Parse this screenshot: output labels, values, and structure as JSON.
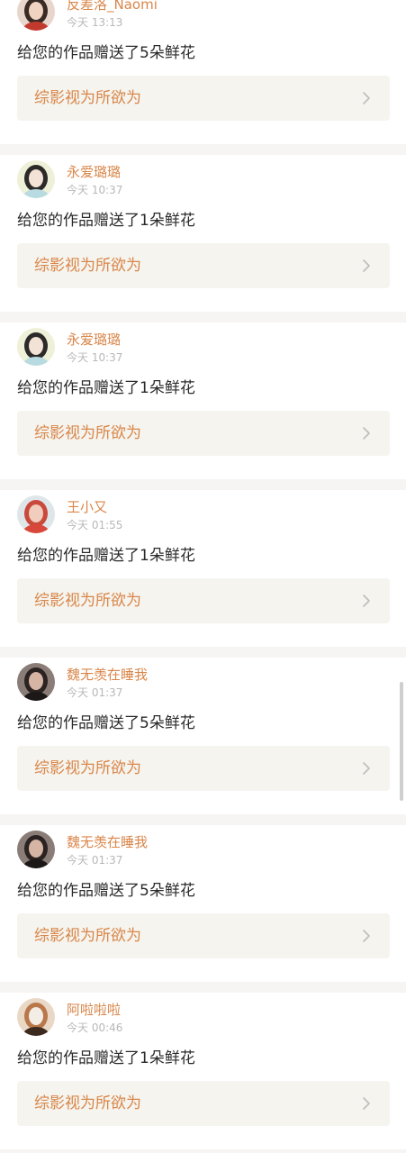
{
  "notifications": [
    {
      "user": "反差洛_Naomi",
      "time": "今天 13:13",
      "message": "给您的作品赠送了5朵鲜花",
      "work_title": "综影视为所欲为",
      "avatar": {
        "bg": "#e8d6cc",
        "hair": "#3a2a24",
        "skin": "#f1d3c2",
        "accent": "#c23a2e"
      }
    },
    {
      "user": "永爱璐璐",
      "time": "今天 10:37",
      "message": "给您的作品赠送了1朵鲜花",
      "work_title": "综影视为所欲为",
      "avatar": {
        "bg": "#eef0d8",
        "hair": "#2c2a28",
        "skin": "#f3e2d6",
        "accent": "#b7dbe0"
      }
    },
    {
      "user": "永爱璐璐",
      "time": "今天 10:37",
      "message": "给您的作品赠送了1朵鲜花",
      "work_title": "综影视为所欲为",
      "avatar": {
        "bg": "#eef0d8",
        "hair": "#2c2a28",
        "skin": "#f3e2d6",
        "accent": "#b7dbe0"
      }
    },
    {
      "user": "王小又",
      "time": "今天 01:55",
      "message": "给您的作品赠送了1朵鲜花",
      "work_title": "综影视为所欲为",
      "avatar": {
        "bg": "#dfe6ea",
        "hair": "#c94a3c",
        "skin": "#f0cdbc",
        "accent": "#d8473a"
      }
    },
    {
      "user": "魏无羡在睡我",
      "time": "今天 01:37",
      "message": "给您的作品赠送了5朵鲜花",
      "work_title": "综影视为所欲为",
      "avatar": {
        "bg": "#8a7c77",
        "hair": "#2a2322",
        "skin": "#d6b5a4",
        "accent": "#1c1818"
      }
    },
    {
      "user": "魏无羡在睡我",
      "time": "今天 01:37",
      "message": "给您的作品赠送了5朵鲜花",
      "work_title": "综影视为所欲为",
      "avatar": {
        "bg": "#8a7c77",
        "hair": "#2a2322",
        "skin": "#d6b5a4",
        "accent": "#1c1818"
      }
    },
    {
      "user": "阿啦啦啦",
      "time": "今天 00:46",
      "message": "给您的作品赠送了1朵鲜花",
      "work_title": "综影视为所欲为",
      "avatar": {
        "bg": "#e9d8c6",
        "hair": "#b9774a",
        "skin": "#f4ede6",
        "accent": "#3c2a1e"
      }
    }
  ],
  "icons": {
    "chevron": "chevron-right-icon"
  },
  "colors": {
    "accent": "#d9864a",
    "time": "#b8b8b8",
    "link_bg": "#f5f4ee",
    "separator": "#f7f5f3"
  }
}
